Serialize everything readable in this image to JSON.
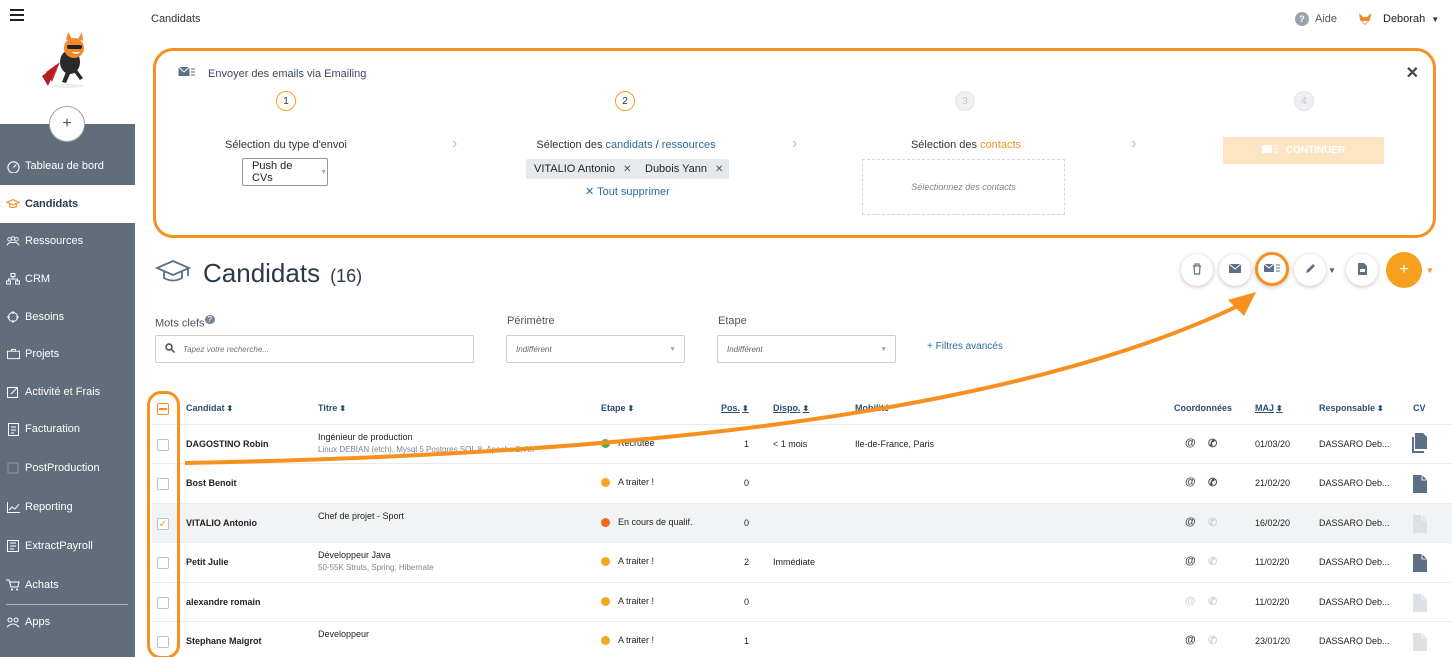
{
  "sidebar": {
    "items": [
      {
        "label": "Tableau de bord",
        "icon": "dashboard-icon"
      },
      {
        "label": "Candidats",
        "icon": "graduation-cap-icon",
        "active": true
      },
      {
        "label": "Ressources",
        "icon": "people-icon"
      },
      {
        "label": "CRM",
        "icon": "sitemap-icon"
      },
      {
        "label": "Besoins",
        "icon": "crosshair-icon"
      },
      {
        "label": "Projets",
        "icon": "briefcase-icon"
      },
      {
        "label": "Activité et Frais",
        "icon": "edit-icon"
      },
      {
        "label": "Facturation",
        "icon": "document-icon"
      },
      {
        "label": "PostProduction",
        "icon": "post-icon"
      },
      {
        "label": "Reporting",
        "icon": "chart-icon"
      },
      {
        "label": "ExtractPayroll",
        "icon": "payroll-icon"
      },
      {
        "label": "Achats",
        "icon": "cart-icon"
      },
      {
        "label": "Apps",
        "icon": "apps-icon"
      }
    ],
    "add_label": "+"
  },
  "topbar": {
    "breadcrumb": "Candidats",
    "help": "Aide",
    "user": "Deborah"
  },
  "panel": {
    "title": "Envoyer des emails via Emailing",
    "steps": [
      {
        "num": "1",
        "label": "Sélection du type d'envoi"
      },
      {
        "num": "2",
        "label_prefix": "Sélection des",
        "label_blue1": "candidats",
        "label_sep": " / ",
        "label_blue2": "ressources"
      },
      {
        "num": "3",
        "label_prefix": "Sélection des",
        "label_orange": "contacts"
      },
      {
        "num": "4"
      }
    ],
    "type_select": "Push de CVs",
    "chips": [
      "VITALIO Antonio",
      "Dubois Yann"
    ],
    "clear_all": "Tout supprimer",
    "contacts_placeholder": "Sélectionnez des contacts",
    "continue": "CONTINUER"
  },
  "page": {
    "title": "Candidats",
    "count": "(16)"
  },
  "filters": {
    "keywords_label": "Mots clefs",
    "keywords_help": "?",
    "search_placeholder": "Tapez votre recherche...",
    "perimeter_label": "Périmètre",
    "perimeter_value": "Indifférent",
    "stage_label": "Etape",
    "stage_value": "Indifférent",
    "advanced": "+ Filtres avancés"
  },
  "table": {
    "headers": {
      "candidat": "Candidat",
      "titre": "Titre",
      "etape": "Etape",
      "pos": "Pos.",
      "dispo": "Dispo.",
      "mobilite": "Mobilité",
      "coordonnees": "Coordonnées",
      "maj": "MAJ",
      "responsable": "Responsable",
      "cv": "CV"
    },
    "rows": [
      {
        "name": "DAGOSTINO Robin",
        "title": "Ingénieur de production",
        "subtitle": "Linux DEBIAN (etch), Mysql 5 Postgres SQL 8, Apache 2, Ah",
        "stage": "Recrutée",
        "stage_color": "#4caf50",
        "pos": "1",
        "dispo": "< 1 mois",
        "mobility": "Ile-de-France, Paris",
        "maj": "01/03/20",
        "owner": "DASSARO Deb...",
        "checked": false
      },
      {
        "name": "Bost Benoit",
        "title": "",
        "subtitle": "",
        "stage": "A traiter !",
        "stage_color": "#f5a623",
        "pos": "0",
        "dispo": "",
        "mobility": "",
        "maj": "21/02/20",
        "owner": "DASSARO Deb...",
        "checked": false
      },
      {
        "name": "VITALIO Antonio",
        "title": "Chef de projet - Sport",
        "subtitle": "",
        "stage": "En cours de qualif.",
        "stage_color": "#f06a1e",
        "pos": "0",
        "dispo": "",
        "mobility": "",
        "maj": "16/02/20",
        "owner": "DASSARO Deb...",
        "checked": true
      },
      {
        "name": "Petit Julie",
        "title": "Développeur Java",
        "subtitle": "50-55K Struts, Spring, Hibernate",
        "stage": "A traiter !",
        "stage_color": "#f5a623",
        "pos": "2",
        "dispo": "Immédiate",
        "mobility": "",
        "maj": "11/02/20",
        "owner": "DASSARO Deb...",
        "checked": false
      },
      {
        "name": "alexandre romain",
        "title": "",
        "subtitle": "",
        "stage": "A traiter !",
        "stage_color": "#f5a623",
        "pos": "0",
        "dispo": "",
        "mobility": "",
        "maj": "11/02/20",
        "owner": "DASSARO Deb...",
        "checked": false
      },
      {
        "name": "Stephane Maigrot",
        "title": "Developpeur",
        "subtitle": "",
        "stage": "A traiter !",
        "stage_color": "#f5a623",
        "pos": "1",
        "dispo": "",
        "mobility": "",
        "maj": "23/01/20",
        "owner": "DASSARO Deb...",
        "checked": false
      }
    ]
  },
  "colors": {
    "accent": "#f7901e",
    "sidebar": "#616d7a",
    "link": "#2e6b9e"
  }
}
